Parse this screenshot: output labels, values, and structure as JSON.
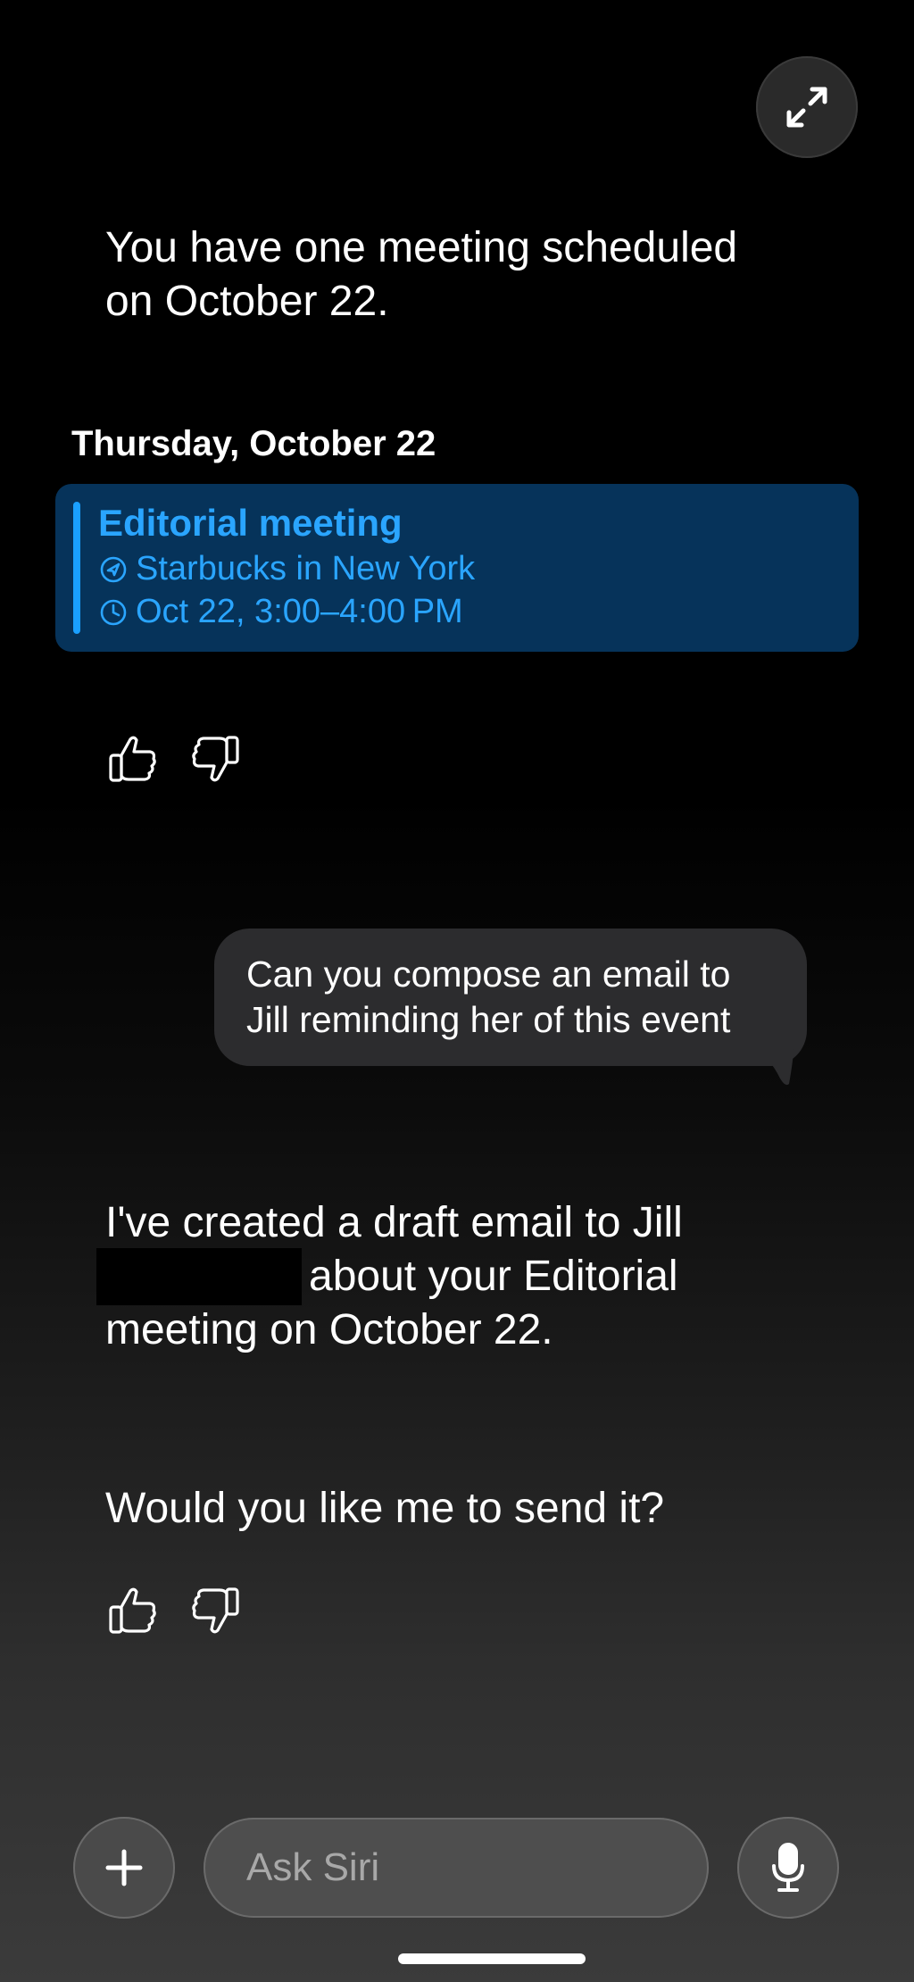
{
  "header": {
    "expand_icon": "arrows-expand-icon"
  },
  "conversation": {
    "assistant_intro": "You have one meeting scheduled\non October 22.",
    "date_header": "Thursday, October 22",
    "event": {
      "title": "Editorial meeting",
      "location": "Starbucks in New York",
      "time": "Oct 22, 3:00–4:00 PM",
      "accent_color": "#1aa0ff",
      "card_color": "#06335a"
    },
    "feedback": {
      "like_icon": "thumbs-up-icon",
      "dislike_icon": "thumbs-down-icon"
    },
    "user_message": "Can you compose an email to\nJill reminding her of this event",
    "assistant_reply_line1": "I've created a draft email to Jill",
    "assistant_reply_line2": "about your Editorial",
    "assistant_reply_line3": "meeting on October 22.",
    "assistant_question": "Would you like me to send it?"
  },
  "input_bar": {
    "add_icon": "plus-icon",
    "placeholder": "Ask Siri",
    "mic_icon": "microphone-icon"
  }
}
